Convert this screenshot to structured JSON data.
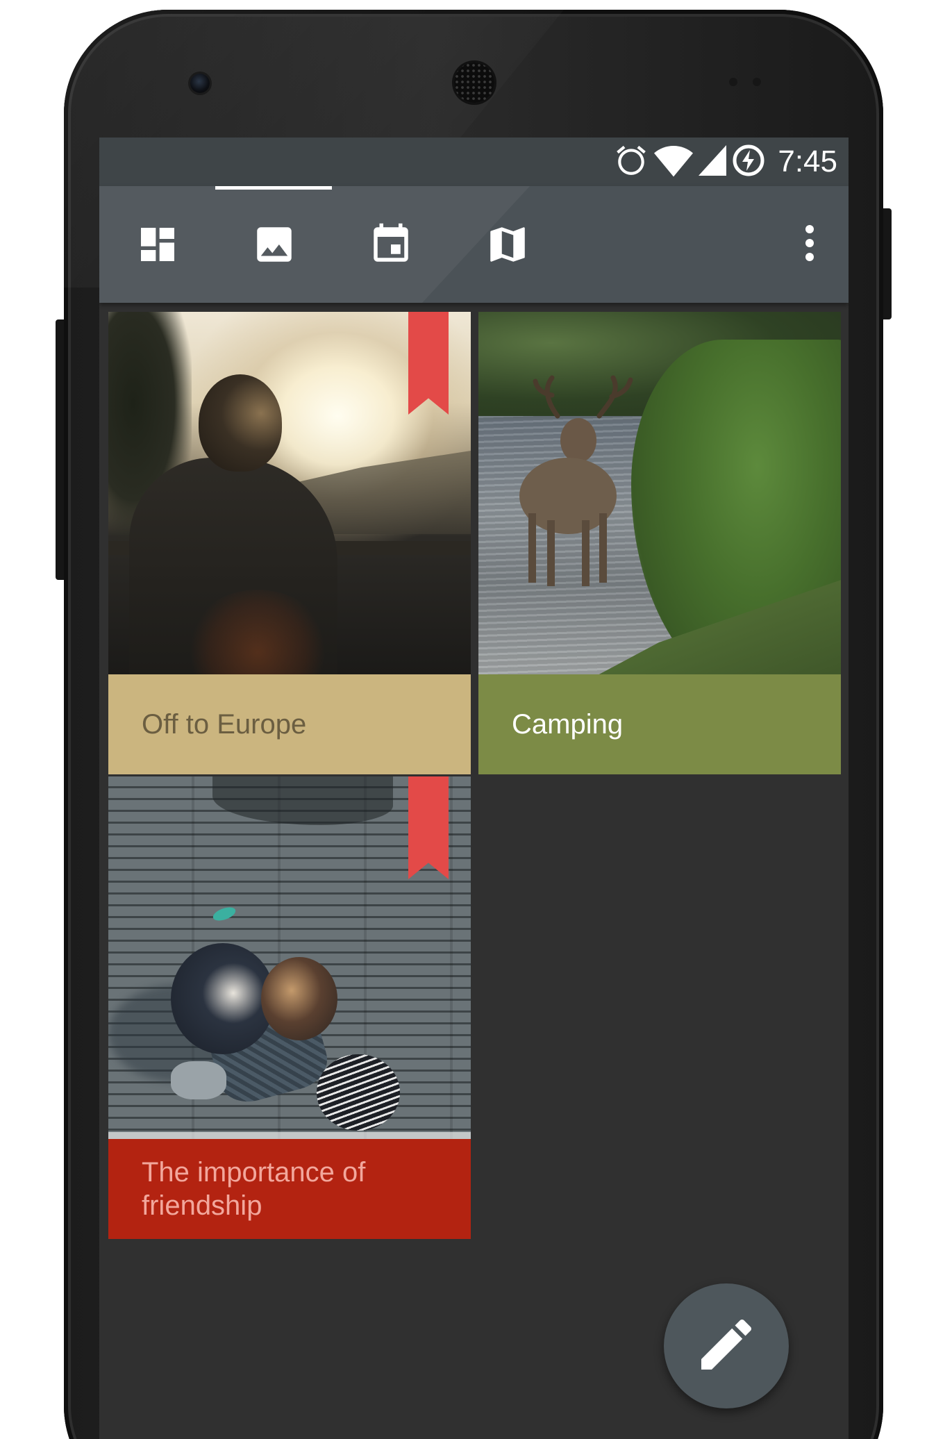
{
  "status_bar": {
    "time": "7:45",
    "icons": [
      "alarm-icon",
      "wifi-icon",
      "cellular-signal-icon",
      "battery-charging-icon"
    ]
  },
  "app_bar": {
    "tabs": [
      {
        "icon": "dashboard-icon",
        "selected": true
      },
      {
        "icon": "image-icon",
        "selected": false
      },
      {
        "icon": "calendar-icon",
        "selected": false
      },
      {
        "icon": "map-icon",
        "selected": false
      }
    ],
    "overflow_icon": "more-vert-icon"
  },
  "cards": [
    {
      "title": "Off to Europe",
      "caption_color": "#cbb57f",
      "text_color": "#6b5e41",
      "bookmarked": true,
      "photo": "man-at-sunset"
    },
    {
      "title": "Camping",
      "caption_color": "#7c8b46",
      "text_color": "#ffffff",
      "bookmarked": false,
      "photo": "reindeer-in-river"
    },
    {
      "title": "The importance of friendship",
      "caption_color": "#b32311",
      "text_color": "#f2a79c",
      "bookmarked": true,
      "photo": "friends-on-boardwalk"
    }
  ],
  "fab": {
    "icon": "edit-icon"
  },
  "colors": {
    "screen_bg": "#303030",
    "app_bar": "#4b5257",
    "status_bar": "#3f4548",
    "bookmark": "#e34a48",
    "fab": "#4e575c"
  }
}
